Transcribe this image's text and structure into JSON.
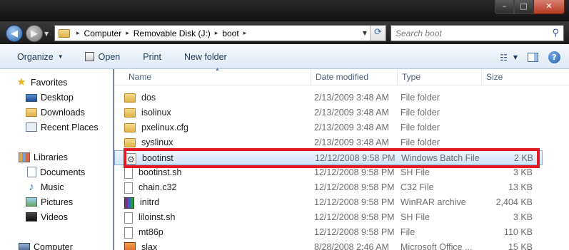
{
  "window": {
    "controls": {
      "minimize": "–",
      "maximize": "□",
      "close": "✕"
    }
  },
  "address": {
    "crumbs": [
      "Computer",
      "Removable Disk (J:)",
      "boot"
    ],
    "separator": "▸"
  },
  "search": {
    "placeholder": "Search boot"
  },
  "toolbar": {
    "organize": "Organize",
    "open": "Open",
    "print": "Print",
    "new_folder": "New folder"
  },
  "nav": {
    "favorites": "Favorites",
    "desktop": "Desktop",
    "downloads": "Downloads",
    "recent_places": "Recent Places",
    "libraries": "Libraries",
    "documents": "Documents",
    "music": "Music",
    "pictures": "Pictures",
    "videos": "Videos",
    "computer": "Computer"
  },
  "columns": {
    "name": "Name",
    "date": "Date modified",
    "type": "Type",
    "size": "Size"
  },
  "files": [
    {
      "name": "dos",
      "date": "2/13/2009 3:48 AM",
      "type": "File folder",
      "size": "",
      "icon": "folder"
    },
    {
      "name": "isolinux",
      "date": "2/13/2009 3:48 AM",
      "type": "File folder",
      "size": "",
      "icon": "folder"
    },
    {
      "name": "pxelinux.cfg",
      "date": "2/13/2009 3:48 AM",
      "type": "File folder",
      "size": "",
      "icon": "folder"
    },
    {
      "name": "syslinux",
      "date": "2/13/2009 3:48 AM",
      "type": "File folder",
      "size": "",
      "icon": "folder"
    },
    {
      "name": "bootinst",
      "date": "12/12/2008 9:58 PM",
      "type": "Windows Batch File",
      "size": "2 KB",
      "icon": "batch-file"
    },
    {
      "name": "bootinst.sh",
      "date": "12/12/2008 9:58 PM",
      "type": "SH File",
      "size": "3 KB",
      "icon": "file"
    },
    {
      "name": "chain.c32",
      "date": "12/12/2008 9:58 PM",
      "type": "C32 File",
      "size": "13 KB",
      "icon": "file"
    },
    {
      "name": "initrd",
      "date": "12/12/2008 9:58 PM",
      "type": "WinRAR archive",
      "size": "2,404 KB",
      "icon": "rar"
    },
    {
      "name": "liloinst.sh",
      "date": "12/12/2008 9:58 PM",
      "type": "SH File",
      "size": "3 KB",
      "icon": "file"
    },
    {
      "name": "mt86p",
      "date": "12/12/2008 9:58 PM",
      "type": "File",
      "size": "110 KB",
      "icon": "file"
    },
    {
      "name": "slax",
      "date": "8/28/2008 2:46 AM",
      "type": "Microsoft Office ...",
      "size": "15 KB",
      "icon": "office"
    }
  ],
  "colors": {
    "highlight": "#e01b24",
    "selection": "#cfe4fc"
  }
}
